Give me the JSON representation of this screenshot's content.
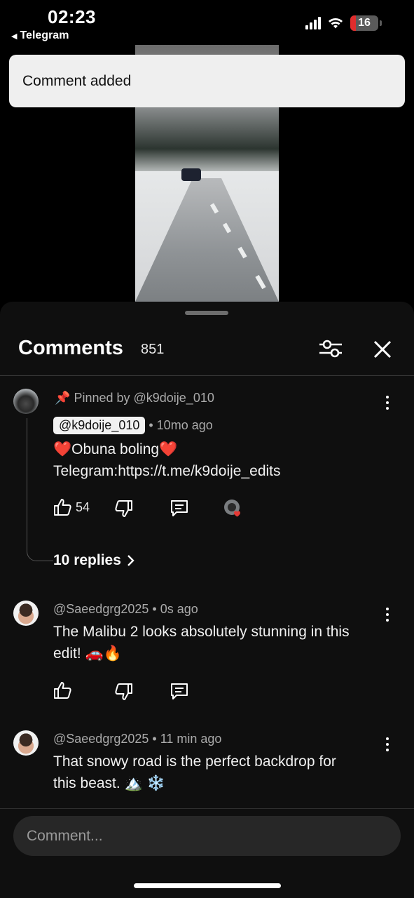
{
  "status_bar": {
    "time": "02:23",
    "back_app": "Telegram",
    "battery": "16",
    "battery_color": "#e02d2d"
  },
  "toast": {
    "message": "Comment added"
  },
  "comments_panel": {
    "title": "Comments",
    "count": "851",
    "filter_icon": "sliders-icon",
    "close_icon": "close-icon"
  },
  "comments": [
    {
      "pinned_label": "Pinned by @k9doije_010",
      "author": "@k9doije_010",
      "time": "10mo ago",
      "text_line1": "❤️Obuna boling❤️",
      "text_line2": "Telegram:https://t.me/k9doije_edits",
      "likes": "54",
      "replies": "10 replies"
    },
    {
      "author": "@Saeedgrg2025",
      "time": "0s ago",
      "text_line1": "The Malibu 2 looks absolutely stunning in this",
      "text_line2": "edit! 🚗🔥"
    },
    {
      "author": "@Saeedgrg2025",
      "time": "11 min ago",
      "text_line1": "That snowy road is the perfect backdrop for",
      "text_line2": "this beast. 🏔️ ❄️"
    }
  ],
  "input": {
    "placeholder": "Comment..."
  },
  "colors": {
    "background": "#000000",
    "sheet": "#0f0f0f",
    "toast": "#efefef",
    "input": "#272727",
    "like_heart": "#e53935"
  }
}
